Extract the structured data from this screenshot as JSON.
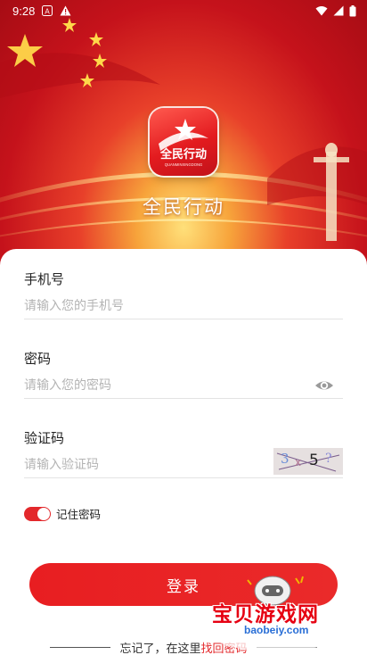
{
  "status_bar": {
    "time": "9:28"
  },
  "app": {
    "title": "全民行动",
    "logo_text": "全民行动",
    "logo_subtext": "QUANMINXINGDONG"
  },
  "form": {
    "phone": {
      "label": "手机号",
      "placeholder": "请输入您的手机号"
    },
    "password": {
      "label": "密码",
      "placeholder": "请输入您的密码"
    },
    "captcha": {
      "label": "验证码",
      "placeholder": "请输入验证码",
      "image_text": "3x5?"
    },
    "remember": {
      "label": "记住密码",
      "checked": true
    },
    "login_label": "登录"
  },
  "footer": {
    "forgot_prefix": "忘记了，在这里",
    "forgot_link": "找回密码"
  },
  "watermark": {
    "text": "宝贝游戏网",
    "url": "baobeiy.com"
  },
  "colors": {
    "primary": "#e3282b",
    "hero_dark": "#a60c14",
    "hero_glow": "#ffe07a"
  }
}
